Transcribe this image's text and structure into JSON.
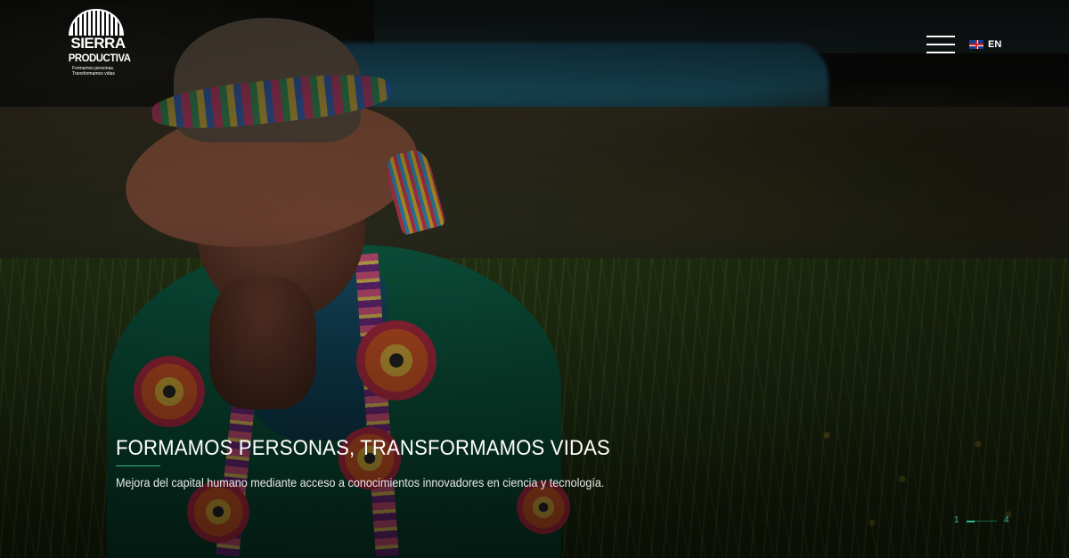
{
  "brand": {
    "name_line1": "SIERRA",
    "name_line2": "PRODUCTIVA",
    "tagline": "Formamos personas. Transformamos vidas"
  },
  "header": {
    "menu_icon": "hamburger-menu-icon",
    "language": {
      "flag_icon": "uk-flag-icon",
      "label": "EN"
    }
  },
  "slide": {
    "title": "FORMAMOS PERSONAS, TRANSFORMAMOS VIDAS",
    "subtitle": "Mejora del capital humano mediante acceso a conocimientos innovadores en ciencia y tecnología."
  },
  "pager": {
    "current": "1",
    "total": "4",
    "progress": 0.25
  },
  "colors": {
    "accent": "#2fb89a",
    "text": "#ffffff"
  }
}
